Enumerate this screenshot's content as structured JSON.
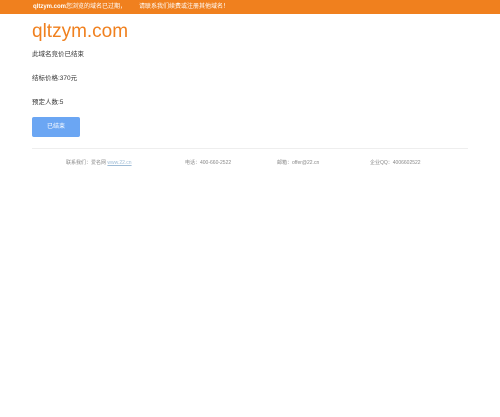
{
  "topbar": {
    "domain": "qltzym.com",
    "message": "您浏览的域名已过期，",
    "message2": "请联系我们续费或注册其他域名！"
  },
  "main": {
    "title": "qltzym.com",
    "status": "此域名竞价已结束",
    "price": "结标价格:370元",
    "bidders": "预定人数:5",
    "ended_button": "已结束"
  },
  "footer": {
    "contact_label": "联系我们：爱名网 ",
    "contact_link": "www.22.cn",
    "phone": "电话：400-660-2522",
    "email": "邮箱：offer@22.cn",
    "qq": "企业QQ：4006602522"
  },
  "colors": {
    "accent": "#f0801e",
    "button": "#6ba6f3"
  }
}
